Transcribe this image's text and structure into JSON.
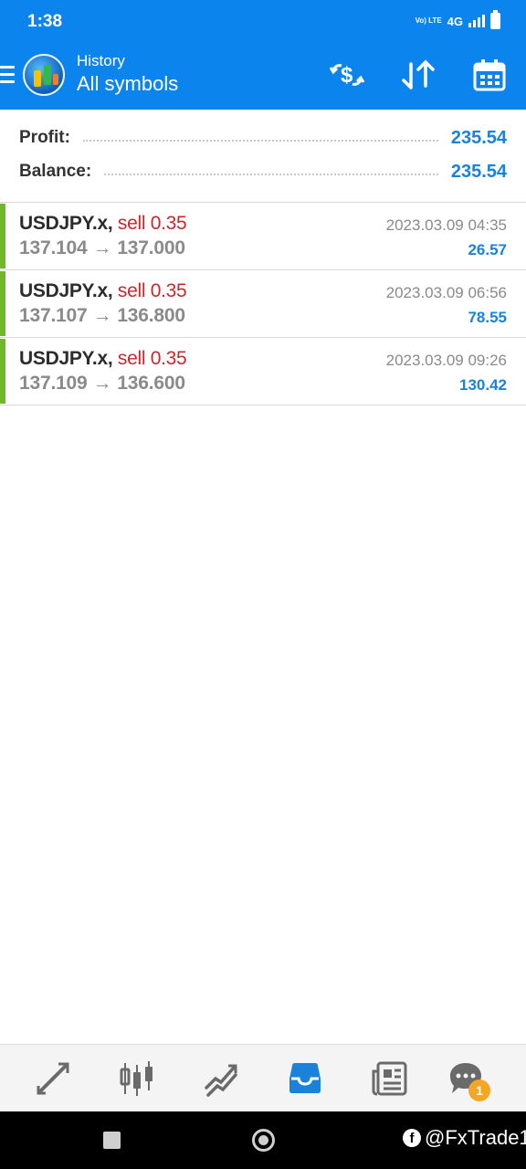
{
  "status_bar": {
    "time": "1:38",
    "network_label": "4G",
    "volte_label": "Vo) LTE"
  },
  "app_bar": {
    "subtitle": "History",
    "title": "All symbols"
  },
  "summary": {
    "profit_label": "Profit:",
    "profit_value": "235.54",
    "balance_label": "Balance:",
    "balance_value": "235.54"
  },
  "deals": [
    {
      "symbol": "USDJPY.x,",
      "side": "sell 0.35",
      "open_price": "137.104",
      "arrow": "→",
      "close_price": "137.000",
      "time": "2023.03.09 04:35",
      "profit": "26.57"
    },
    {
      "symbol": "USDJPY.x,",
      "side": "sell 0.35",
      "open_price": "137.107",
      "arrow": "→",
      "close_price": "136.800",
      "time": "2023.03.09 06:56",
      "profit": "78.55"
    },
    {
      "symbol": "USDJPY.x,",
      "side": "sell 0.35",
      "open_price": "137.109",
      "arrow": "→",
      "close_price": "136.600",
      "time": "2023.03.09 09:26",
      "profit": "130.42"
    }
  ],
  "bottom_nav": {
    "items": [
      "quotes-icon",
      "chart-icon",
      "trade-icon",
      "history-icon",
      "news-icon",
      "chat-icon"
    ],
    "active_color": "#1a82d8",
    "chat_badge": "1"
  },
  "watermark": {
    "text": "@FxTrade1"
  },
  "colors": {
    "accent": "#0b84ee",
    "profit": "#1a82d8",
    "sell": "#c52a2a",
    "deal_bar": "#6fb82a"
  }
}
